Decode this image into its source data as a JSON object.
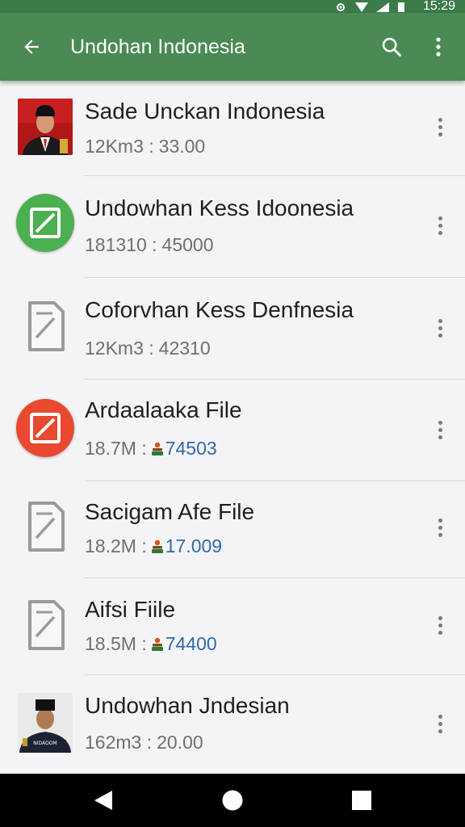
{
  "status_bar": {
    "time": "15:29",
    "icons": [
      "settings-icon",
      "wifi-icon",
      "signal-icon",
      "battery-icon"
    ]
  },
  "app_bar": {
    "title": "Undohan Indonesia",
    "icons": [
      "back-arrow-icon",
      "search-icon",
      "more-vert-icon"
    ]
  },
  "colors": {
    "app_bar": "#4a8a55",
    "status_bar": "#3c7a48",
    "green_icon": "#4caf50",
    "red_icon": "#e8492f",
    "blue_value": "#2f6aa8"
  },
  "files": [
    {
      "title": "Sade Unckan Indonesia",
      "meta": "12Km3 :",
      "value": "33.00",
      "icon": "portrait-photo",
      "people_icon": false
    },
    {
      "title": "Undowhan  Kess Idoonesia",
      "meta": "181310 :",
      "value": "45000",
      "icon": "green-file-icon",
      "people_icon": false
    },
    {
      "title": "Coforvhan Kess Denfnesia",
      "meta": "12Km3 :",
      "value": "42310",
      "icon": "document-icon",
      "people_icon": false
    },
    {
      "title": "Ardaalaaka File",
      "meta": "18.7M :",
      "value": "74503",
      "icon": "red-file-icon",
      "people_icon": true
    },
    {
      "title": "Sacigam Afe File",
      "meta": "18.2M :",
      "value": "17.009",
      "icon": "document-icon",
      "people_icon": true
    },
    {
      "title": "Aifsi Fiile",
      "meta": "18.5M :",
      "value": "74400",
      "icon": "document-icon",
      "people_icon": true
    },
    {
      "title": "Undowhan Jndesian",
      "meta": "162m3 :",
      "value": "20.00",
      "icon": "portrait-photo",
      "people_icon": false
    }
  ],
  "nav_bar": {
    "icons": [
      "back-triangle-icon",
      "home-circle-icon",
      "recents-square-icon"
    ]
  }
}
